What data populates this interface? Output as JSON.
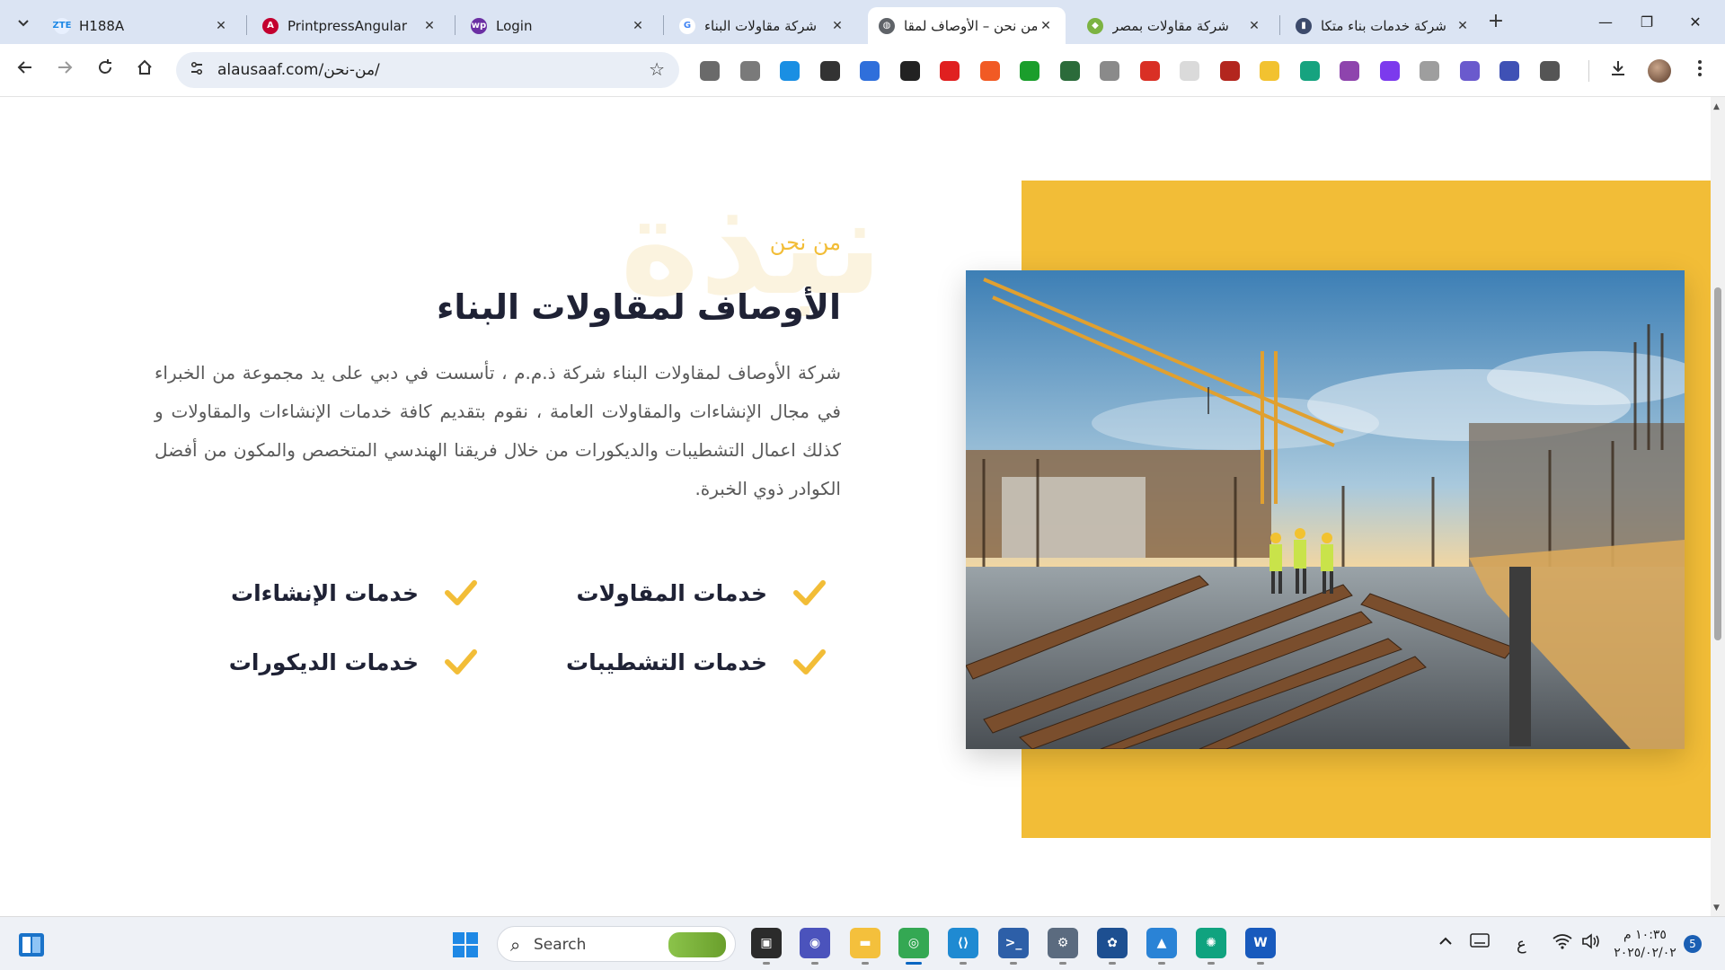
{
  "browser": {
    "tabs": [
      {
        "title": "H188A",
        "favicon_text": "ZTE",
        "favicon_color": "#e8f0fe",
        "favicon_fg": "#1e88e5",
        "active": false
      },
      {
        "title": "PrintpressAngular",
        "favicon_text": "A",
        "favicon_color": "#c3002f",
        "favicon_fg": "#ffffff",
        "active": false
      },
      {
        "title": "Login",
        "favicon_text": "wp",
        "favicon_color": "#6b2fa3",
        "favicon_fg": "#ffffff",
        "active": false
      },
      {
        "title": "شركة مقاولات البناء",
        "favicon_text": "G",
        "favicon_color": "#ffffff",
        "favicon_fg": "#4285f4",
        "active": false
      },
      {
        "title": "من نحن – الأوصاف لمقا",
        "favicon_text": "◍",
        "favicon_color": "#5f6368",
        "favicon_fg": "#ffffff",
        "active": true
      },
      {
        "title": "شركة مقاولات بمصر",
        "favicon_text": "◆",
        "favicon_color": "#7cb342",
        "favicon_fg": "#ffffff",
        "active": false
      },
      {
        "title": "شركة خدمات بناء متكا",
        "favicon_text": "▮",
        "favicon_color": "#3c4a6b",
        "favicon_fg": "#ffffff",
        "active": false
      }
    ],
    "close_glyph": "✕",
    "new_tab_glyph": "+",
    "url": "alausaaf.com/من-نحن/",
    "window_controls": {
      "minimize": "—",
      "restore": "❐",
      "close": "✕"
    }
  },
  "page": {
    "watermark": "نبذة",
    "subtitle": "من نحن",
    "heading": "الأوصاف لمقاولات البناء",
    "paragraph": "شركة الأوصاف لمقاولات البناء شركة ذ.م.م ، تأسست في دبي على يد مجموعة من الخبراء في مجال الإنشاءات والمقاولات العامة ، نقوم بتقديم كافة خدمات الإنشاءات والمقاولات و كذلك اعمال التشطيبات والديكورات من خلال فريقنا الهندسي المتخصص والمكون من أفضل الكوادر ذوي الخبرة.",
    "services": [
      "خدمات المقاولات",
      "خدمات الإنشاءات",
      "خدمات التشطيبات",
      "خدمات الديكورات"
    ],
    "accent_color": "#f2bd37",
    "heading_color": "#1f2235"
  },
  "taskbar": {
    "search_placeholder": "Search",
    "clock_time": "١٠:٣٥ م",
    "clock_date": "٢٠٢٥/٠٢/٠٢",
    "input_language": "ع",
    "notification_count": "5",
    "apps": [
      {
        "name": "task-view",
        "color": "#2b2b2b",
        "glyph": "▣"
      },
      {
        "name": "meet",
        "color": "#4b53bc",
        "glyph": "◉"
      },
      {
        "name": "file-explorer",
        "color": "#f4c03c",
        "glyph": "▬"
      },
      {
        "name": "chrome",
        "color": "#34a853",
        "glyph": "◎"
      },
      {
        "name": "vscode",
        "color": "#1f8ad2",
        "glyph": "⟨⟩"
      },
      {
        "name": "powershell",
        "color": "#2d5fa8",
        "glyph": ">_"
      },
      {
        "name": "settings",
        "color": "#5b6b7f",
        "glyph": "⚙"
      },
      {
        "name": "media-player",
        "color": "#1d4f91",
        "glyph": "✿"
      },
      {
        "name": "photos",
        "color": "#2a83d6",
        "glyph": "▲"
      },
      {
        "name": "chatgpt",
        "color": "#10a37f",
        "glyph": "✺"
      },
      {
        "name": "word",
        "color": "#185abd",
        "glyph": "W"
      }
    ]
  }
}
